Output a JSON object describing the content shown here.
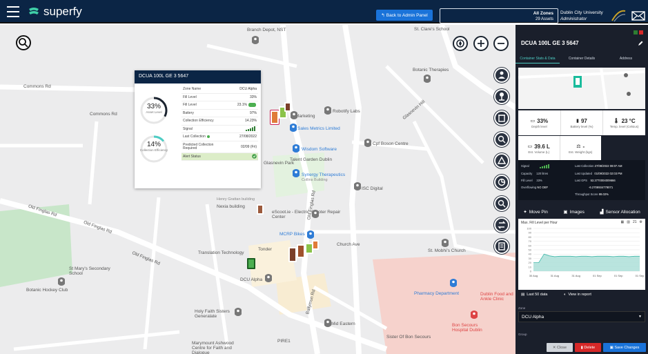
{
  "app": {
    "brand": "superfy",
    "back_button": "Back to Admin Panel",
    "zone_title": "All Zones",
    "zone_assets": "29 Assets",
    "org_name": "Dublin City University",
    "org_role": "Administrator"
  },
  "map": {
    "labels": [
      "Commons Rd",
      "Commons Rd",
      "Glasnevin Park",
      "Old Finglas Rd",
      "Old Finglas Rd",
      "Old Finglas Rd",
      "Marketing",
      "Robotify Labs",
      "Sales Metrics Limited",
      "Wisdom Software",
      "Talent Garden Dublin",
      "Synergy Therapeutics",
      "Collins Building",
      "Cpf Boson Centre",
      "ISC Digital",
      "Henry Grattan building",
      "Nexia building",
      "eScoot.ie - Electric Scooter Repair Center",
      "MCRP Bikes",
      "Tonder",
      "Translation Technology",
      "DCU Alpha",
      "Church Ave",
      "St. Mobhi's Church",
      "St Mary's Secondary School",
      "Botanic Hockey Club",
      "Holy Faith Sisters Generalate",
      "Mid Eastern",
      "Bon Secours Hospital Dublin",
      "Pharmacy Department",
      "Dublin Food and Ankle Clinic",
      "Sister Of Bon Secours",
      "PIRE1",
      "Marymount Ashwood Centre for Faith and Dialogue",
      "Botanic Therapies",
      "St. Clare's School",
      "Branch Depot, NST",
      "Old Finglas Rd",
      "Ballymun Rd",
      "Glasnevin Hill"
    ],
    "label_colors": {
      "road": "#555555",
      "business": "#2e7cd6",
      "health": "#d44444"
    }
  },
  "popup": {
    "title": "DCUA 100L GE 3 5647",
    "asset_level_value": "33%",
    "asset_level_label": "Asset Level",
    "efficiency_value": "14%",
    "efficiency_label": "Collection Efficiency",
    "asset_level_fraction": 0.33,
    "efficiency_fraction": 0.14,
    "rows": [
      {
        "label": "Zone Name",
        "value": "DCU Alpha"
      },
      {
        "label": "Fill Level",
        "value": "33%"
      },
      {
        "label": "Fill Level",
        "value": "23.1%"
      },
      {
        "label": "Battery",
        "value": "97%"
      },
      {
        "label": "Collection Efficiency",
        "value": "14.23%"
      },
      {
        "label": "Signal",
        "value": ""
      },
      {
        "label": "Last Collection",
        "value": "27/08/2022"
      },
      {
        "label": "Predicted Collection Required",
        "value": "02/09 (Fri)"
      },
      {
        "label": "Alert Status",
        "value": ""
      }
    ]
  },
  "sidebar": {
    "title": "DCUA 100L GE 3 5647",
    "tabs": [
      "Container Stats & Data",
      "Container Details",
      "Address"
    ],
    "stats_row1": [
      {
        "value": "33%",
        "label": "Depth level"
      },
      {
        "value": "97",
        "label": "Battery level (%)"
      },
      {
        "value": "23 °C",
        "label": "Temp. level (Celsius)"
      }
    ],
    "stats_row2": [
      {
        "value": "39.6 L",
        "label": "Est. Volume (L)"
      },
      {
        "value": "-",
        "label": "Est. Weight (kgs)"
      }
    ],
    "info_left": [
      {
        "label": "Signal",
        "value": ""
      },
      {
        "label": "Capacity",
        "value": "120 litres"
      },
      {
        "label": "Fill Level",
        "value": "33%"
      },
      {
        "label": "Overflowing",
        "value": "NO DEF"
      }
    ],
    "info_right": [
      {
        "label": "Last Collection",
        "value": "27/08/2022 08:07 AM"
      },
      {
        "label": "Last Updated",
        "value": "01/09/2022 02:03 PM"
      },
      {
        "label": "Last GPS",
        "value": "53.3770004009666"
      },
      {
        "label": "",
        "value": "-6.2708934778071"
      },
      {
        "label": "Throughput Score",
        "value": "99.02%"
      }
    ],
    "actions": [
      "Move Pin",
      "Images",
      "Sensor Allocation"
    ],
    "chart_title": "Max. Fill Level per Hour",
    "lower_actions": [
      "Last 50 data",
      "View in report"
    ],
    "zone_label": "Zone",
    "zone_value": "DCU Alpha",
    "group_label": "Group",
    "buttons": [
      "Close",
      "Delete",
      "Save Changes"
    ],
    "colors": {
      "accent": "#4ecdc4",
      "close": "#6b7280",
      "delete": "#d62828",
      "save": "#1a73d9"
    }
  },
  "chart_data": {
    "type": "area",
    "title": "Max. Fill Level per Hour",
    "x": [
      "30 Aug",
      "31 Aug",
      "31 Aug",
      "01 Sep",
      "01 Sep",
      "01 Sep"
    ],
    "series": [
      {
        "values": [
          20,
          20,
          40,
          36,
          34,
          35,
          35,
          35,
          34,
          35,
          35,
          34,
          35,
          35,
          35,
          34,
          35,
          35,
          34,
          35,
          35
        ]
      }
    ],
    "ylim": [
      0,
      100
    ],
    "yticks": [
      "100",
      "90",
      "80",
      "70",
      "60",
      "50",
      "40",
      "30",
      "20",
      "10",
      "0"
    ],
    "grid": true
  }
}
